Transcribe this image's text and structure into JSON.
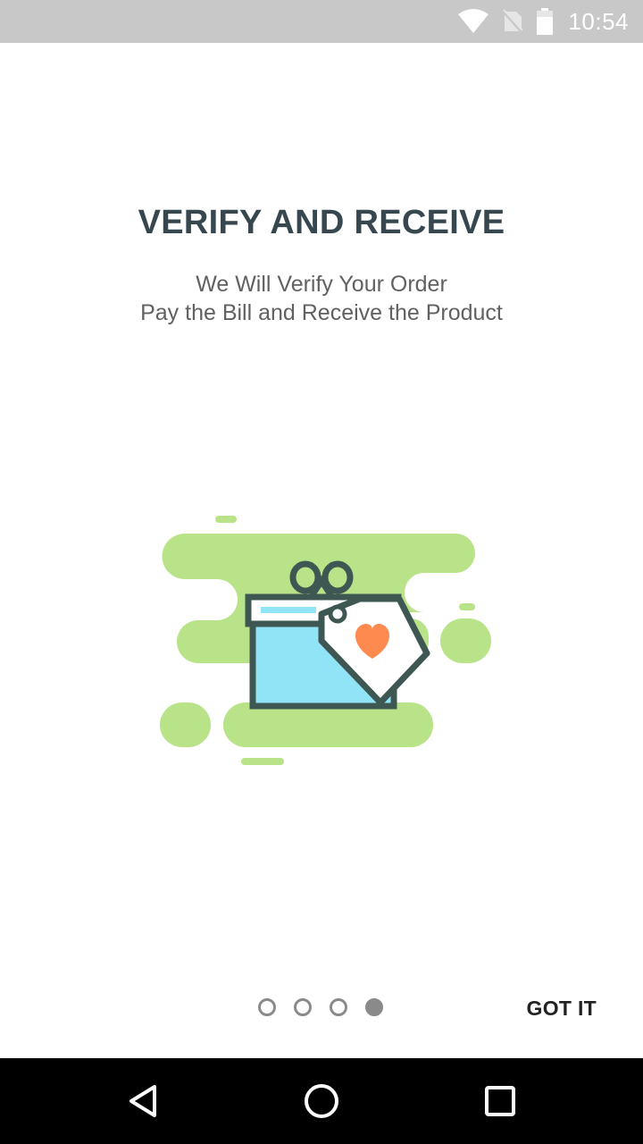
{
  "status_bar": {
    "time": "10:54",
    "icons": [
      "wifi-icon",
      "no-sim-icon",
      "battery-icon"
    ]
  },
  "onboarding": {
    "title": "VERIFY AND RECEIVE",
    "description_line1": "We Will Verify Your Order",
    "description_line2": "Pay the Bill and Receive the Product",
    "illustration": "gift-box-with-price-tag",
    "pager": {
      "total": 4,
      "current": 4
    },
    "got_it_label": "GOT IT"
  },
  "nav_bar": {
    "icons": [
      "back-icon",
      "home-icon",
      "recents-icon"
    ]
  },
  "colors": {
    "status_bar": "#c8c8c8",
    "title": "#37474f",
    "description": "#616161",
    "blob_green": "#b9e388",
    "box_blue": "#91e3f6",
    "outline": "#3f5753",
    "heart": "#ff8a50",
    "nav_bar": "#000000"
  }
}
